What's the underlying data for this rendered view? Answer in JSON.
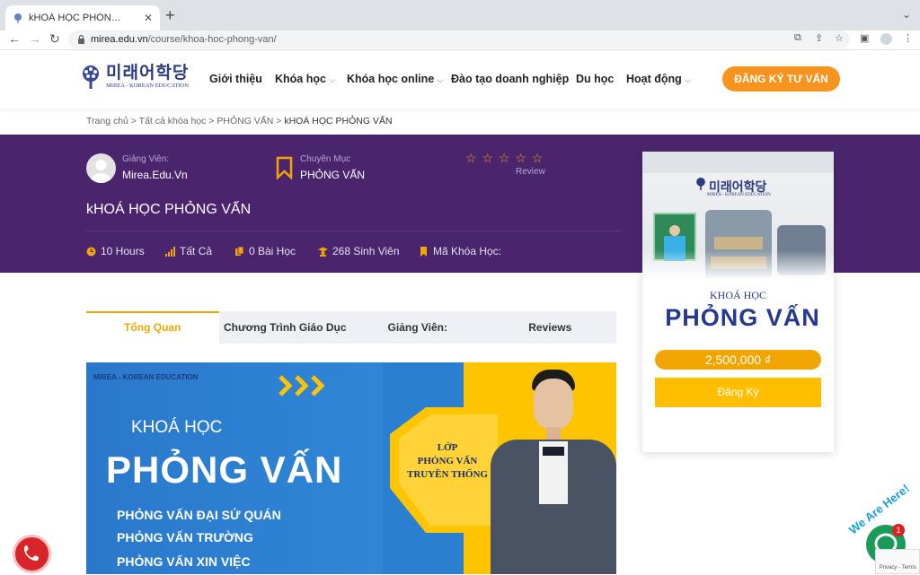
{
  "browser": {
    "tab_title": "kHOÁ HỌC PHỎNG VẤN - Trung",
    "url_host": "mirea.edu.vn",
    "url_path": "/course/khoa-hoc-phong-van/"
  },
  "site": {
    "logo_korean": "미래어학당",
    "logo_english": "MIREA - KOREAN EDUCATION",
    "menu": [
      {
        "label": "Giới thiệu",
        "has_dropdown": false
      },
      {
        "label": "Khóa học",
        "has_dropdown": true
      },
      {
        "label": "Khóa học online",
        "has_dropdown": true
      },
      {
        "label": "Đào tạo doanh nghiệp",
        "has_dropdown": false
      },
      {
        "label": "Du học",
        "has_dropdown": false
      },
      {
        "label": "Hoạt động",
        "has_dropdown": true
      }
    ],
    "cta_label": "ĐĂNG KÝ TƯ VẤN",
    "accent_color": "#f7941d"
  },
  "breadcrumb": {
    "home": "Trang chủ",
    "all": "Tất cả khóa học",
    "category": "PHỎNG VẤN",
    "current": "kHOÁ HỌC PHỎNG VẤN"
  },
  "course": {
    "instructor_label": "Giảng Viên:",
    "instructor_name": "Mirea.Edu.Vn",
    "category_label": "Chuyên Mục",
    "category_name": "PHỎNG VẤN",
    "stars": "☆ ☆ ☆ ☆ ☆",
    "review_label": "Review",
    "title": "kHOÁ HỌC PHỎNG VẤN",
    "meta": {
      "hours": "10 Hours",
      "level": "Tất Cả",
      "lessons": "0 Bài Học",
      "students": "268 Sinh Viên",
      "code": "Mã Khóa Học:"
    },
    "hero_color": "#4a256e"
  },
  "card": {
    "logo_korean": "미래어학당",
    "logo_english": "MIREA - KOREAN EDUCATION",
    "khoa_hoc": "KHOÁ HỌC",
    "name": "PHỎNG VẤN",
    "price": "2,500,000 ₫",
    "enroll_label": "Đăng Ký"
  },
  "tabs": [
    {
      "label": "Tổng Quan",
      "active": true
    },
    {
      "label": "Chương Trình Giáo Dục",
      "active": false
    },
    {
      "label": "Giảng Viên:",
      "active": false
    },
    {
      "label": "Reviews",
      "active": false
    }
  ],
  "banner": {
    "logo": "MIREA - KOREAN EDUCATION",
    "khoa_hoc": "KHOÁ HỌC",
    "title": "PHỎNG VẤN",
    "items": [
      "PHỎNG VẤN ĐẠI SỨ QUÁN",
      "PHỎNG VẤN TRƯỜNG",
      "PHỎNG VẤN XIN VIỆC"
    ],
    "hex_text": [
      "LỚP",
      "PHỎNG VẤN",
      "TRUYỀN THỐNG"
    ]
  },
  "widgets": {
    "we_are_here": "We Are Here!",
    "chat_badge": "1",
    "recaptcha": "Privacy - Terms"
  }
}
